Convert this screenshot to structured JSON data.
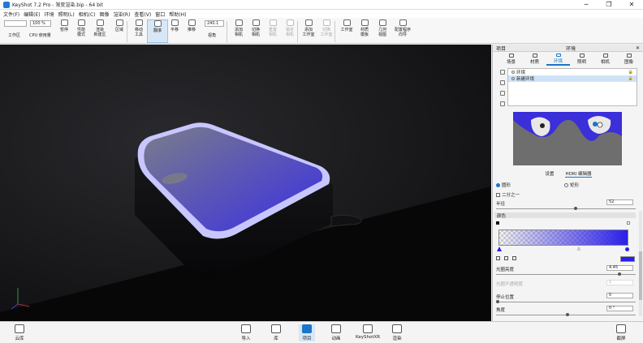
{
  "window": {
    "title": "KeyShot 7.2 Pro  - 渐变渲染.bip  - 64 bit",
    "buttons": [
      "─",
      "❐",
      "✕"
    ]
  },
  "menu": [
    "文件(F)",
    "编辑(E)",
    "环境",
    "照明(L)",
    "相机(C)",
    "图像",
    "渲染(R)",
    "查看(V)",
    "窗口",
    "帮助(H)"
  ],
  "toolbar": {
    "workspace_select": "",
    "cpu_usage": "100 %",
    "fov_value": "240.1",
    "items": [
      {
        "label": "工作区",
        "name": "workspace"
      },
      {
        "label": "CPU 使用量",
        "name": "cpu-usage"
      },
      {
        "label": "暂停",
        "name": "pause"
      },
      {
        "label": "性能\n模式",
        "name": "performance-mode"
      },
      {
        "label": "渲染\n新建区",
        "name": "denoise"
      },
      {
        "label": "区域",
        "name": "region"
      },
      {
        "label": "移动\n工具",
        "name": "move-tool"
      },
      {
        "label": "翻滚",
        "name": "tumble"
      },
      {
        "label": "平移",
        "name": "pan"
      },
      {
        "label": "推移",
        "name": "dolly"
      },
      {
        "label": "视角",
        "name": "perspective"
      },
      {
        "label": "添加\n相机",
        "name": "add-camera"
      },
      {
        "label": "切换\n相机",
        "name": "switch-camera"
      },
      {
        "label": "重置\n相机",
        "name": "reset-camera"
      },
      {
        "label": "锁定\n相机",
        "name": "lock-camera"
      },
      {
        "label": "添加\n工作室",
        "name": "add-studio"
      },
      {
        "label": "切换\n工作室",
        "name": "switch-studio"
      },
      {
        "label": "工作室",
        "name": "studio"
      },
      {
        "label": "材质\n模板",
        "name": "material-template"
      },
      {
        "label": "几何\n视图",
        "name": "geometry-view"
      },
      {
        "label": "配置程序\n向导",
        "name": "configurator-wizard"
      }
    ]
  },
  "panel": {
    "left_title": "项目",
    "title": "环境",
    "tabs": [
      "场景",
      "材质",
      "环境",
      "照明",
      "相机",
      "图像"
    ],
    "active_tab": "环境",
    "environments": [
      {
        "name": "环境",
        "selected": false
      },
      {
        "name": "新建环境",
        "selected": true
      }
    ],
    "subtabs": [
      "设置",
      "HDRI 编辑器"
    ],
    "active_subtab": "HDRI 编辑器",
    "shape_options": [
      "圆形",
      "矩形"
    ],
    "shape_selected": "圆形",
    "half_label": "二分之一",
    "radius_label": "半径",
    "radius_value": "52",
    "color_section": "颜色",
    "brightness_label": "光圈亮度",
    "brightness_value": "4.45",
    "opacity_label": "光圈不透明度",
    "opacity_value": "1",
    "stop_label": "停止位置",
    "stop_value": "0",
    "angle_label": "角度",
    "angle_value": "0 °",
    "accent_color": "#1a76c9",
    "gradient_color": "#2a1fe8"
  },
  "bottom": {
    "cloud": "云库",
    "items": [
      "导入",
      "库",
      "项目",
      "动画",
      "KeyShotXR",
      "渲染"
    ],
    "active": "项目",
    "screenshot": "截屏"
  }
}
